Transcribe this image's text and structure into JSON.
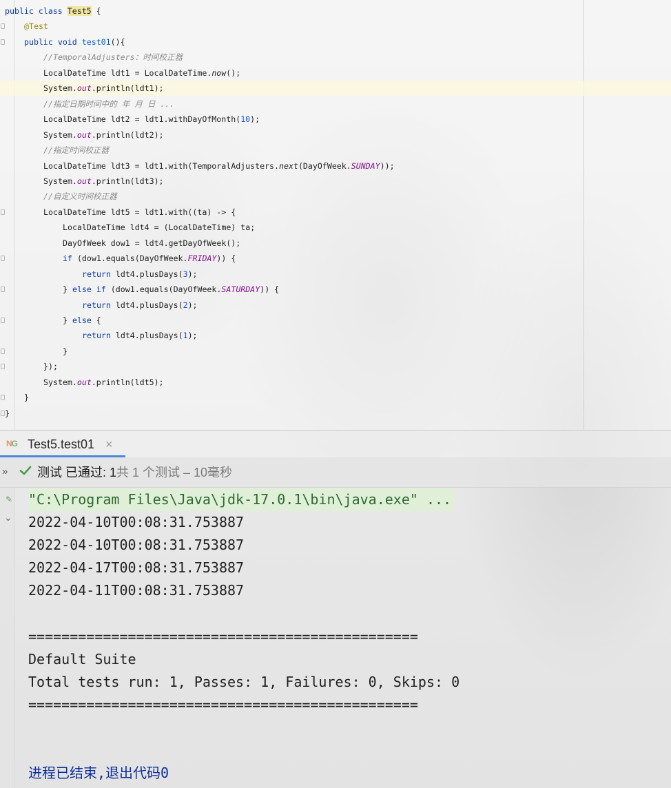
{
  "editor": {
    "lines": [
      {
        "indent": 0,
        "segments": [
          {
            "t": "public class ",
            "c": "kw"
          },
          {
            "t": "Test5",
            "c": "cls-hl"
          },
          {
            "t": " {",
            "c": "ident"
          }
        ]
      },
      {
        "indent": 1,
        "segments": [
          {
            "t": "@Test",
            "c": "ann"
          }
        ]
      },
      {
        "indent": 1,
        "segments": [
          {
            "t": "public void ",
            "c": "kw"
          },
          {
            "t": "test01",
            "c": "fn"
          },
          {
            "t": "(){",
            "c": "ident"
          }
        ]
      },
      {
        "indent": 2,
        "segments": [
          {
            "t": "//TemporalAdjusters：时间校正器",
            "c": "cmt"
          }
        ]
      },
      {
        "indent": 2,
        "segments": [
          {
            "t": "LocalDateTime ldt1 = LocalDateTime.",
            "c": "ident"
          },
          {
            "t": "now",
            "c": "static-m"
          },
          {
            "t": "();",
            "c": "ident"
          }
        ]
      },
      {
        "indent": 2,
        "current": true,
        "segments": [
          {
            "t": "System.",
            "c": "ident"
          },
          {
            "t": "out",
            "c": "st"
          },
          {
            "t": ".println(ldt1);",
            "c": "ident"
          }
        ]
      },
      {
        "indent": 2,
        "segments": [
          {
            "t": "//指定日期时间中的 年 月 日 ...",
            "c": "cmt"
          }
        ]
      },
      {
        "indent": 2,
        "segments": [
          {
            "t": "LocalDateTime ldt2 = ldt1.withDayOfMonth(",
            "c": "ident"
          },
          {
            "t": "10",
            "c": "num"
          },
          {
            "t": ");",
            "c": "ident"
          }
        ]
      },
      {
        "indent": 2,
        "segments": [
          {
            "t": "System.",
            "c": "ident"
          },
          {
            "t": "out",
            "c": "st"
          },
          {
            "t": ".println(ldt2);",
            "c": "ident"
          }
        ]
      },
      {
        "indent": 2,
        "segments": [
          {
            "t": "//指定时间校正器",
            "c": "cmt"
          }
        ]
      },
      {
        "indent": 2,
        "segments": [
          {
            "t": "LocalDateTime ldt3 = ldt1.with(TemporalAdjusters.",
            "c": "ident"
          },
          {
            "t": "next",
            "c": "static-m"
          },
          {
            "t": "(DayOfWeek.",
            "c": "ident"
          },
          {
            "t": "SUNDAY",
            "c": "st"
          },
          {
            "t": "));",
            "c": "ident"
          }
        ]
      },
      {
        "indent": 2,
        "segments": [
          {
            "t": "System.",
            "c": "ident"
          },
          {
            "t": "out",
            "c": "st"
          },
          {
            "t": ".println(ldt3);",
            "c": "ident"
          }
        ]
      },
      {
        "indent": 2,
        "segments": [
          {
            "t": "//自定义时间校正器",
            "c": "cmt"
          }
        ]
      },
      {
        "indent": 2,
        "segments": [
          {
            "t": "LocalDateTime ldt5 = ldt1.with((ta) -> {",
            "c": "ident"
          }
        ]
      },
      {
        "indent": 3,
        "segments": [
          {
            "t": "LocalDateTime ldt4 = (LocalDateTime) ta;",
            "c": "ident"
          }
        ]
      },
      {
        "indent": 3,
        "segments": [
          {
            "t": "DayOfWeek dow1 = ldt4.getDayOfWeek();",
            "c": "ident"
          }
        ]
      },
      {
        "indent": 3,
        "segments": [
          {
            "t": "if",
            "c": "kw"
          },
          {
            "t": " (dow1.equals(DayOfWeek.",
            "c": "ident"
          },
          {
            "t": "FRIDAY",
            "c": "st"
          },
          {
            "t": ")) {",
            "c": "ident"
          }
        ]
      },
      {
        "indent": 4,
        "segments": [
          {
            "t": "return",
            "c": "kw"
          },
          {
            "t": " ldt4.plusDays(",
            "c": "ident"
          },
          {
            "t": "3",
            "c": "num"
          },
          {
            "t": ");",
            "c": "ident"
          }
        ]
      },
      {
        "indent": 3,
        "segments": [
          {
            "t": "} ",
            "c": "ident"
          },
          {
            "t": "else if",
            "c": "kw"
          },
          {
            "t": " (dow1.equals(DayOfWeek.",
            "c": "ident"
          },
          {
            "t": "SATURDAY",
            "c": "st"
          },
          {
            "t": ")) {",
            "c": "ident"
          }
        ]
      },
      {
        "indent": 4,
        "segments": [
          {
            "t": "return",
            "c": "kw"
          },
          {
            "t": " ldt4.plusDays(",
            "c": "ident"
          },
          {
            "t": "2",
            "c": "num"
          },
          {
            "t": ");",
            "c": "ident"
          }
        ]
      },
      {
        "indent": 3,
        "segments": [
          {
            "t": "} ",
            "c": "ident"
          },
          {
            "t": "else",
            "c": "kw"
          },
          {
            "t": " {",
            "c": "ident"
          }
        ]
      },
      {
        "indent": 4,
        "segments": [
          {
            "t": "return",
            "c": "kw"
          },
          {
            "t": " ldt4.plusDays(",
            "c": "ident"
          },
          {
            "t": "1",
            "c": "num"
          },
          {
            "t": ");",
            "c": "ident"
          }
        ]
      },
      {
        "indent": 3,
        "segments": [
          {
            "t": "}",
            "c": "ident"
          }
        ]
      },
      {
        "indent": 2,
        "segments": [
          {
            "t": "});",
            "c": "ident"
          }
        ]
      },
      {
        "indent": 2,
        "segments": [
          {
            "t": "System.",
            "c": "ident"
          },
          {
            "t": "out",
            "c": "st"
          },
          {
            "t": ".println(ldt5);",
            "c": "ident"
          }
        ]
      },
      {
        "indent": 1,
        "segments": [
          {
            "t": "}",
            "c": "ident"
          }
        ]
      },
      {
        "indent": 0,
        "segments": [
          {
            "t": "}",
            "c": "ident"
          }
        ]
      }
    ]
  },
  "run_panel": {
    "tab_icon": "testng-icon",
    "tab_icon_letters": {
      "a": "N",
      "b": "G"
    },
    "tab_label": "Test5.test01",
    "tab_close": "×",
    "expand_glyph": "»",
    "status_pass": "测试 已通过: 1",
    "status_detail": "共 1 个测试 – 10毫秒",
    "pass_color": "#4a9c4a"
  },
  "console": {
    "command": "\"C:\\Program Files\\Java\\jdk-17.0.1\\bin\\java.exe\" ...",
    "output_lines": [
      "2022-04-10T00:08:31.753887",
      "2022-04-10T00:08:31.753887",
      "2022-04-17T00:08:31.753887",
      "2022-04-11T00:08:31.753887",
      "",
      "===============================================",
      "Default Suite",
      "Total tests run: 1, Passes: 1, Failures: 0, Skips: 0",
      "===============================================",
      "",
      "",
      "进程已结束,退出代码0"
    ]
  }
}
